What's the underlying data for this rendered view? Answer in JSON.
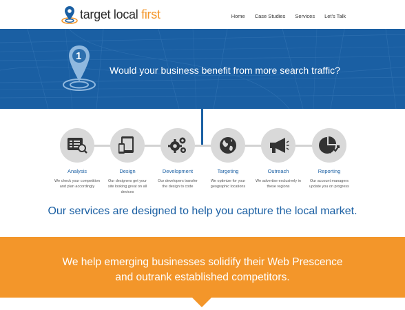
{
  "logo": {
    "text_main": "target local ",
    "text_accent": "first"
  },
  "nav": [
    "Home",
    "Case Studies",
    "Services",
    "Let's Talk"
  ],
  "hero": {
    "badge_number": "1",
    "title": "Would your business benefit from more search traffic?"
  },
  "steps": [
    {
      "label": "Analysis",
      "desc": "We check your competition and plan accordingly",
      "icon": "analysis-icon"
    },
    {
      "label": "Design",
      "desc": "Our designers get your site looking great on all devices",
      "icon": "devices-icon"
    },
    {
      "label": "Development",
      "desc": "Our developers transfer the design to code",
      "icon": "gears-icon"
    },
    {
      "label": "Targeting",
      "desc": "We optimize for your geographic locations",
      "icon": "globe-icon"
    },
    {
      "label": "Outreach",
      "desc": "We advertise exclusively in these regions",
      "icon": "megaphone-icon"
    },
    {
      "label": "Reporting",
      "desc": "Our account managers update you on progress",
      "icon": "chart-icon"
    }
  ],
  "tagline": "Our services are designed to help you capture the local market.",
  "band": {
    "line1": "We help emerging businesses solidify their Web Prescence",
    "line2": "and outrank established competitors."
  },
  "colors": {
    "brand_blue": "#1a5fa3",
    "accent_orange": "#f3962a",
    "step_gray": "#d9d9d9"
  }
}
